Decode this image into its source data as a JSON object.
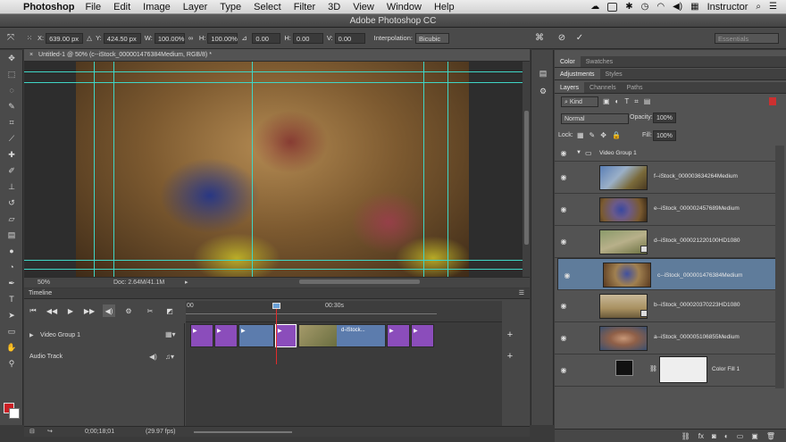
{
  "menubar": {
    "app": "Photoshop",
    "items": [
      "File",
      "Edit",
      "Image",
      "Layer",
      "Type",
      "Select",
      "Filter",
      "3D",
      "View",
      "Window",
      "Help"
    ],
    "user": "Instructor"
  },
  "window": {
    "title": "Adobe Photoshop CC"
  },
  "options": {
    "x_label": "X:",
    "x_value": "639.00 px",
    "y_label": "Y:",
    "y_value": "424.50 px",
    "w_label": "W:",
    "w_value": "100.00%",
    "h_label": "H:",
    "h_value": "100.00%",
    "angle_value": "0.00",
    "hskew_label": "H:",
    "hskew_value": "0.00",
    "vskew_label": "V:",
    "vskew_value": "0.00",
    "interp_label": "Interpolation:",
    "interp_value": "Bicubic",
    "workspace": "Essentials"
  },
  "document": {
    "tab": "Untitled-1 @ 50% (c--iStock_000001476384Medium, RGB/8) *",
    "zoom": "50%",
    "doc_size": "Doc: 2.64M/41.1M"
  },
  "timeline": {
    "title": "Timeline",
    "ruler_start": "00",
    "ruler_mid": "00:30s",
    "video_group": "Video Group 1",
    "audio_track": "Audio Track",
    "clip_label": "d-iStock...",
    "timecode": "0;00;18;01",
    "fps": "(29.97 fps)"
  },
  "panels": {
    "top_tabs": [
      "Color",
      "Swatches"
    ],
    "mid_tabs": [
      "Adjustments",
      "Styles"
    ],
    "layer_tabs": [
      "Layers",
      "Channels",
      "Paths"
    ],
    "kind_label": "Kind",
    "blend_mode": "Normal",
    "opacity_label": "Opacity:",
    "opacity_value": "100%",
    "lock_label": "Lock:",
    "fill_label": "Fill:",
    "fill_value": "100%"
  },
  "layers": {
    "group": "Video Group 1",
    "items": [
      "f--iStock_000003634264Medium",
      "e--iStock_000002457689Medium",
      "d--iStock_000021220100HD1080",
      "c--iStock_000001476384Medium",
      "b--iStock_000020370223HD1080",
      "a--iStock_000005106855Medium",
      "Color Fill 1"
    ]
  },
  "colors": {
    "guide": "#3fd6c6",
    "clip_purple": "#8b4dbb",
    "clip_blue": "#5c7cad",
    "playhead": "#e22b2b",
    "selected_layer": "#5f7c9b",
    "foreground": "#cc1f25",
    "background": "#ffffff"
  },
  "icons": [
    "move-tool-icon",
    "marquee-icon",
    "lasso-icon",
    "quick-select-icon",
    "crop-icon",
    "eyedropper-icon",
    "healing-icon",
    "brush-icon",
    "stamp-icon",
    "history-brush-icon",
    "eraser-icon",
    "gradient-icon",
    "blur-icon",
    "dodge-icon",
    "pen-icon",
    "type-icon",
    "path-select-icon",
    "shape-icon",
    "hand-icon",
    "zoom-icon"
  ]
}
